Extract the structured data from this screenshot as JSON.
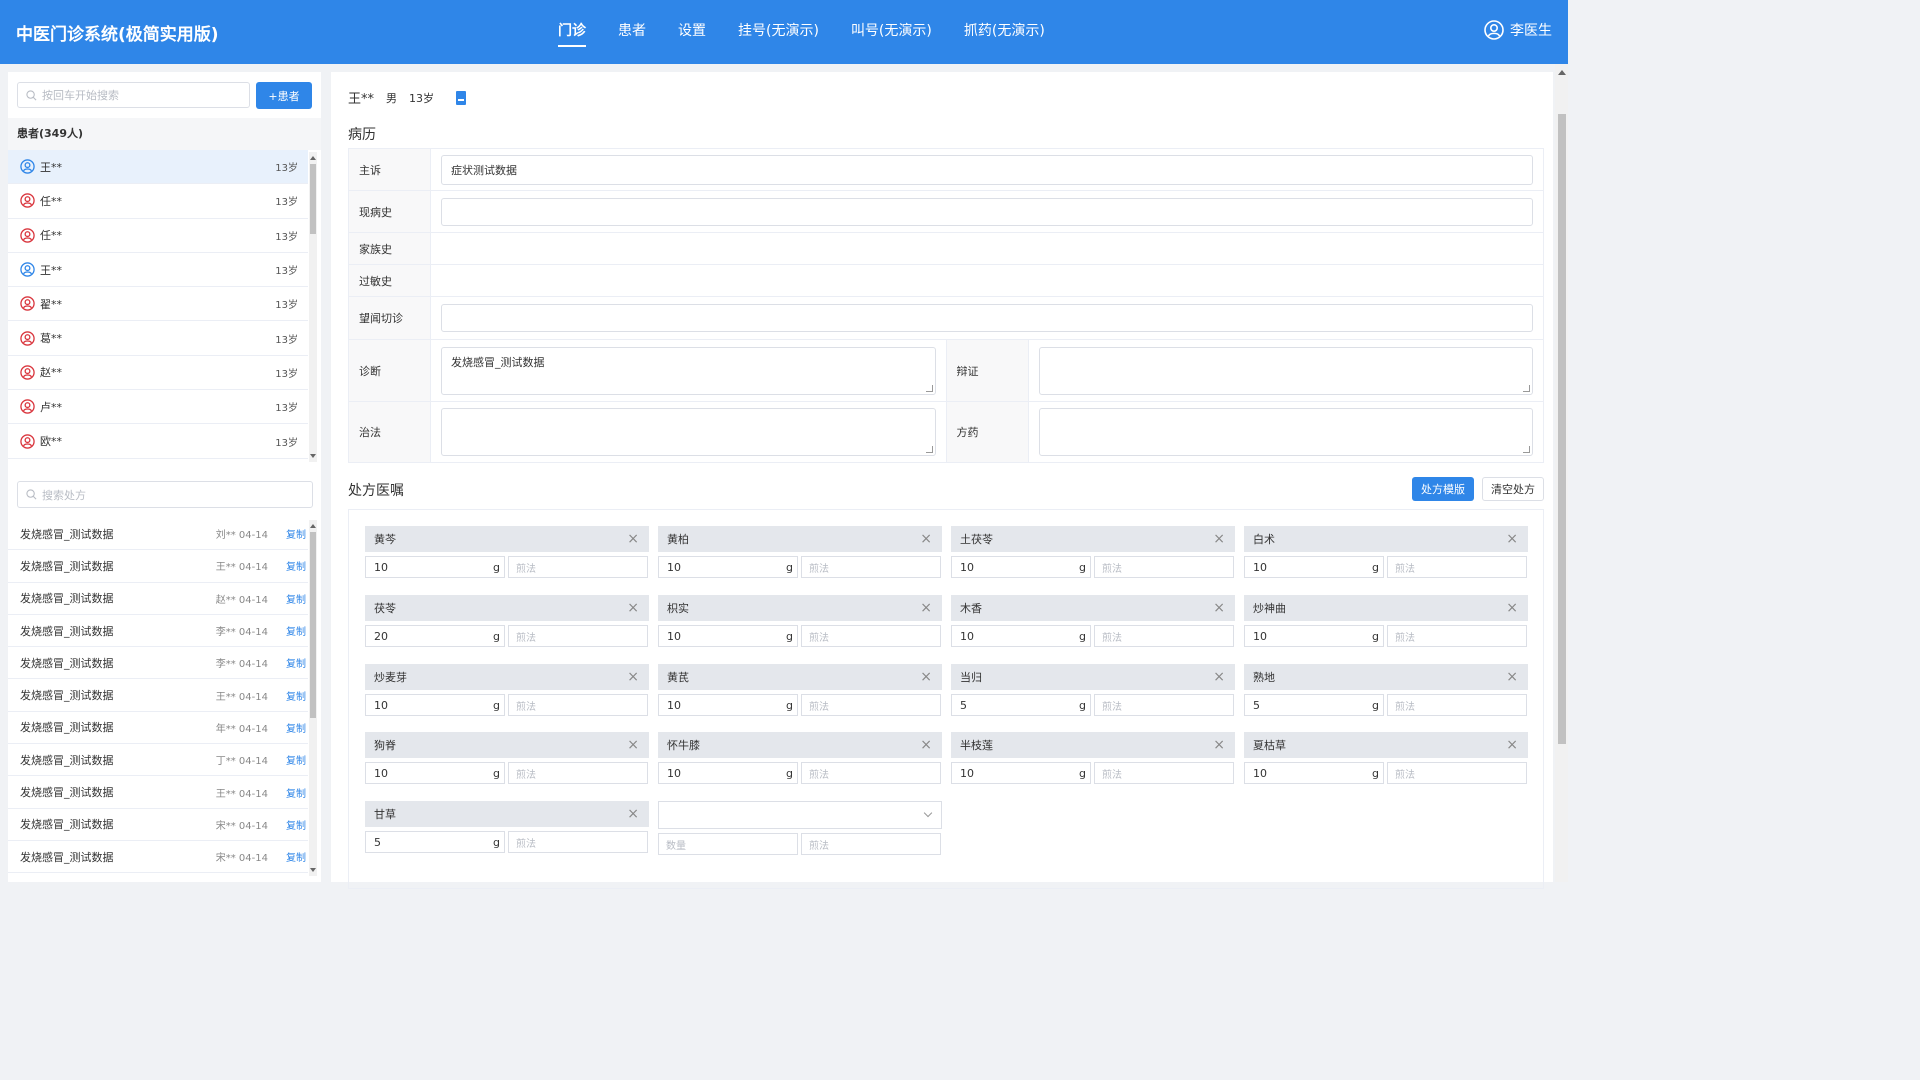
{
  "header": {
    "title": "中医门诊系统(极简实用版)",
    "nav": [
      "门诊",
      "患者",
      "设置",
      "挂号(无演示)",
      "叫号(无演示)",
      "抓药(无演示)"
    ],
    "user": "李医生"
  },
  "left": {
    "search_placeholder": "按回车开始搜索",
    "add_label": "+患者",
    "patients_title": "患者(349人)",
    "patients": [
      {
        "name": "王**",
        "age": "13岁",
        "gender": "male"
      },
      {
        "name": "任**",
        "age": "13岁",
        "gender": "female"
      },
      {
        "name": "任**",
        "age": "13岁",
        "gender": "female"
      },
      {
        "name": "王**",
        "age": "13岁",
        "gender": "male"
      },
      {
        "name": "翟**",
        "age": "13岁",
        "gender": "female"
      },
      {
        "name": "葛**",
        "age": "13岁",
        "gender": "female"
      },
      {
        "name": "赵**",
        "age": "13岁",
        "gender": "female"
      },
      {
        "name": "卢**",
        "age": "13岁",
        "gender": "female"
      },
      {
        "name": "欧**",
        "age": "13岁",
        "gender": "female"
      }
    ],
    "rx_search_placeholder": "搜索处方",
    "prescriptions": [
      {
        "name": "发烧感冒_测试数据",
        "meta": "刘** 04-14",
        "copy": "复制"
      },
      {
        "name": "发烧感冒_测试数据",
        "meta": "王** 04-14",
        "copy": "复制"
      },
      {
        "name": "发烧感冒_测试数据",
        "meta": "赵** 04-14",
        "copy": "复制"
      },
      {
        "name": "发烧感冒_测试数据",
        "meta": "李** 04-14",
        "copy": "复制"
      },
      {
        "name": "发烧感冒_测试数据",
        "meta": "李** 04-14",
        "copy": "复制"
      },
      {
        "name": "发烧感冒_测试数据",
        "meta": "王** 04-14",
        "copy": "复制"
      },
      {
        "name": "发烧感冒_测试数据",
        "meta": "年** 04-14",
        "copy": "复制"
      },
      {
        "name": "发烧感冒_测试数据",
        "meta": "丁** 04-14",
        "copy": "复制"
      },
      {
        "name": "发烧感冒_测试数据",
        "meta": "王** 04-14",
        "copy": "复制"
      },
      {
        "name": "发烧感冒_测试数据",
        "meta": "宋** 04-14",
        "copy": "复制"
      },
      {
        "name": "发烧感冒_测试数据",
        "meta": "宋** 04-14",
        "copy": "复制"
      }
    ]
  },
  "patient": {
    "name": "王**",
    "gender": "男",
    "age": "13岁"
  },
  "record": {
    "title": "病历",
    "chief_complaint_label": "主诉",
    "chief_complaint": "症状测试数据",
    "present_illness_label": "现病史",
    "present_illness": "",
    "family_history_label": "家族史",
    "allergy_label": "过敏史",
    "four_diagnostics_label": "望闻切诊",
    "diagnosis_label": "诊断",
    "diagnosis": "发烧感冒_测试数据",
    "syndrome_label": "辩证",
    "treatment_label": "治法",
    "formula_label": "方药"
  },
  "prescription": {
    "title": "处方医嘱",
    "template_button": "处方模版",
    "clear_button": "清空处方",
    "method_placeholder": "煎法",
    "qty_placeholder": "数量",
    "herbs": [
      {
        "name": "黄芩",
        "dose": "10",
        "unit": "g"
      },
      {
        "name": "黄柏",
        "dose": "10",
        "unit": "g"
      },
      {
        "name": "土茯苓",
        "dose": "10",
        "unit": "g"
      },
      {
        "name": "白术",
        "dose": "10",
        "unit": "g"
      },
      {
        "name": "茯苓",
        "dose": "20",
        "unit": "g"
      },
      {
        "name": "枳实",
        "dose": "10",
        "unit": "g"
      },
      {
        "name": "木香",
        "dose": "10",
        "unit": "g"
      },
      {
        "name": "炒神曲",
        "dose": "10",
        "unit": "g"
      },
      {
        "name": "炒麦芽",
        "dose": "10",
        "unit": "g"
      },
      {
        "name": "黄芪",
        "dose": "10",
        "unit": "g"
      },
      {
        "name": "当归",
        "dose": "5",
        "unit": "g"
      },
      {
        "name": "熟地",
        "dose": "5",
        "unit": "g"
      },
      {
        "name": "狗脊",
        "dose": "10",
        "unit": "g"
      },
      {
        "name": "怀牛膝",
        "dose": "10",
        "unit": "g"
      },
      {
        "name": "半枝莲",
        "dose": "10",
        "unit": "g"
      },
      {
        "name": "夏枯草",
        "dose": "10",
        "unit": "g"
      },
      {
        "name": "甘草",
        "dose": "5",
        "unit": "g"
      }
    ]
  },
  "colors": {
    "primary": "#2f86e8",
    "male": "#2f86e8",
    "female": "#d9363e"
  }
}
